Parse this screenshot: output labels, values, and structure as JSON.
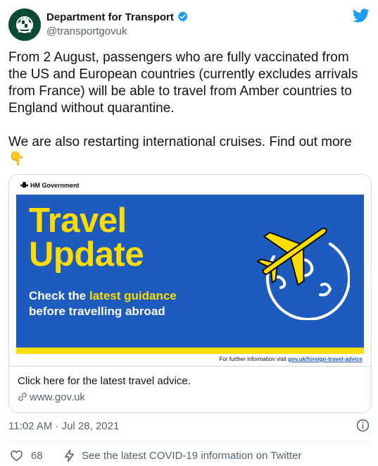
{
  "tweet": {
    "author_name": "Department for Transport",
    "author_handle": "@transportgovuk",
    "verified_icon": "verified-badge-icon",
    "platform_icon": "twitter-bird-icon",
    "text": "From 2 August, passengers who are fully vaccinated from the US and European countries (currently excludes arrivals from France) will be able to travel from Amber countries to England without quarantine.\n\nWe are also restarting international cruises. Find out more\n👇",
    "timestamp": "11:02 AM · Jul 28, 2021",
    "likes": "68",
    "covid_notice": "See the latest COVID-19 information on Twitter"
  },
  "card": {
    "image": {
      "org_label": "HM Government",
      "title_line1": "Travel",
      "title_line2": "Update",
      "sub_prefix": "Check the ",
      "sub_highlight": "latest guidance",
      "sub_line2": "before travelling abroad",
      "footnote_prefix": "For further information visit ",
      "footnote_link": "gov.uk/foreign-travel-advice"
    },
    "description": "Click here for the latest travel advice.",
    "domain": "www.gov.uk"
  },
  "colors": {
    "banner_blue": "#1d5bbf",
    "banner_yellow": "#ffdd00",
    "twitter_blue": "#1d9bf0",
    "secondary_text": "#536471"
  }
}
